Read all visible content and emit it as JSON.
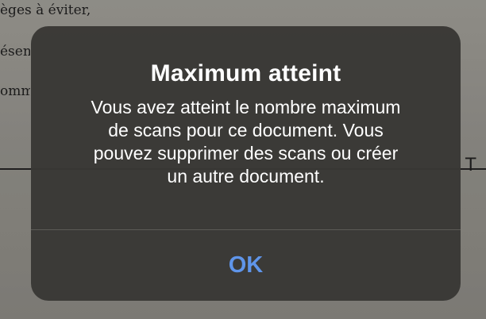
{
  "background_document": {
    "line1": "èges à éviter,",
    "line2": "ésen",
    "line3": "omm",
    "partial_letter": "T"
  },
  "alert": {
    "title": "Maximum atteint",
    "message_lines": [
      "Vous avez atteint le nombre maximum",
      "de scans pour ce document. Vous",
      "pouvez supprimer des scans ou créer",
      "un autre document."
    ],
    "ok_button_label": "OK"
  },
  "colors": {
    "alert_background": "#383734",
    "button_text": "#5f95ea",
    "text": "#ffffff",
    "divider": "#5b5a56"
  }
}
